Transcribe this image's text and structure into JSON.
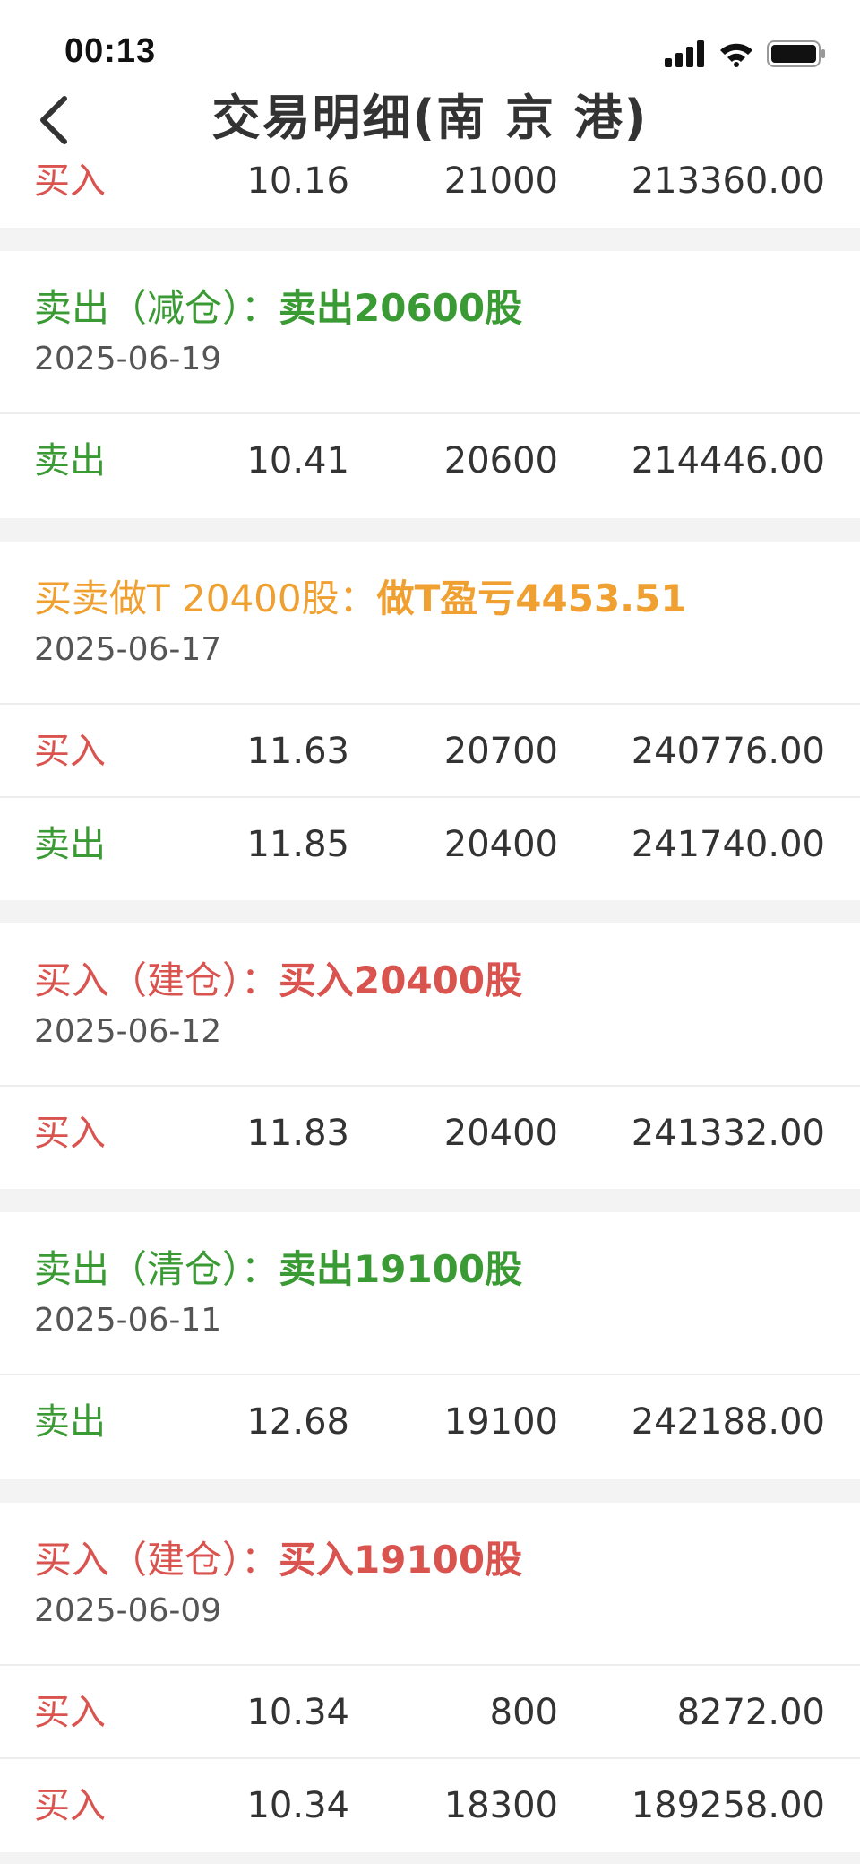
{
  "status_bar": {
    "time": "00:13"
  },
  "nav": {
    "title": "交易明细(南 京 港)"
  },
  "partial_row": {
    "type": "买入",
    "price": "10.16",
    "qty": "21000",
    "amount": "213360.00"
  },
  "groups": [
    {
      "title_prefix": "卖出（减仓）：",
      "title_highlight": "卖出20600股",
      "date": "2025-06-19",
      "rows": [
        {
          "type": "卖出",
          "price": "10.41",
          "qty": "20600",
          "amount": "214446.00"
        }
      ]
    },
    {
      "title_prefix": "买卖做T 20400股：",
      "title_highlight": "做T盈亏4453.51",
      "date": "2025-06-17",
      "rows": [
        {
          "type": "买入",
          "price": "11.63",
          "qty": "20700",
          "amount": "240776.00"
        },
        {
          "type": "卖出",
          "price": "11.85",
          "qty": "20400",
          "amount": "241740.00"
        }
      ]
    },
    {
      "title_prefix": "买入（建仓）：",
      "title_highlight": "买入20400股",
      "date": "2025-06-12",
      "rows": [
        {
          "type": "买入",
          "price": "11.83",
          "qty": "20400",
          "amount": "241332.00"
        }
      ]
    },
    {
      "title_prefix": "卖出（清仓）：",
      "title_highlight": "卖出19100股",
      "date": "2025-06-11",
      "rows": [
        {
          "type": "卖出",
          "price": "12.68",
          "qty": "19100",
          "amount": "242188.00"
        }
      ]
    },
    {
      "title_prefix": "买入（建仓）：",
      "title_highlight": "买入19100股",
      "date": "2025-06-09",
      "rows": [
        {
          "type": "买入",
          "price": "10.34",
          "qty": "800",
          "amount": "8272.00"
        },
        {
          "type": "买入",
          "price": "10.34",
          "qty": "18300",
          "amount": "189258.00"
        }
      ]
    }
  ],
  "colors": {
    "buy": "#d9534f",
    "sell": "#3a9a34",
    "t_trade": "#f0a030",
    "gap": "#f3f3f3"
  }
}
